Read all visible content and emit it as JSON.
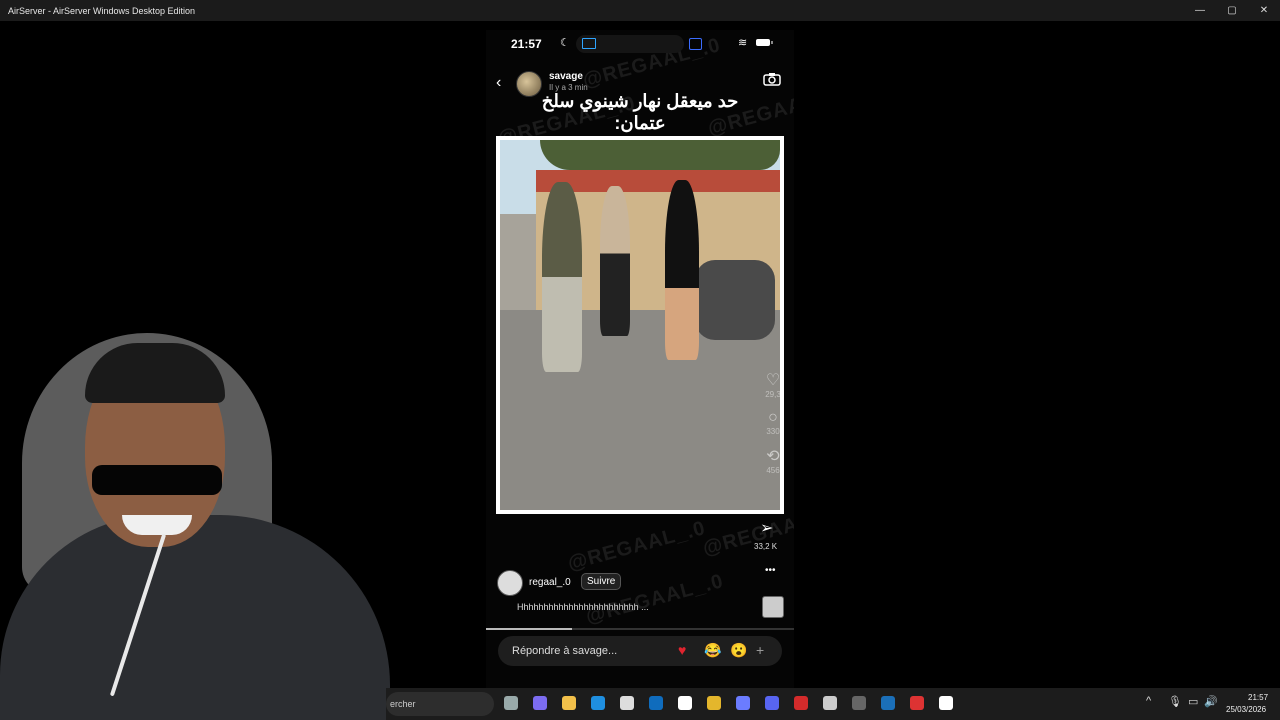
{
  "window": {
    "title": "AirServer - AirServer Windows Desktop Edition"
  },
  "phone": {
    "status": {
      "time": "21:57"
    },
    "story": {
      "username": "savage",
      "posted": "Il y a 3  min",
      "caption_arabic": "حد ميعقل نهار شينوي سلخ عتمان:",
      "watermark": "@REGAAL_.0"
    },
    "side": {
      "likes": "29,3",
      "comments": "330",
      "reposts": "456",
      "shares": "33,2 K"
    },
    "reel": {
      "username": "regaal_.0",
      "follow_label": "Suivre",
      "caption": "Hhhhhhhhhhhhhhhhhhhhhhhh ..."
    },
    "progress": 0.28,
    "reply": {
      "placeholder": "Répondre à savage...",
      "add": "+"
    }
  },
  "taskbar": {
    "search_text": "ercher",
    "time": "21:57",
    "date": "25/03/2026",
    "icons": [
      "file-explorer-icon",
      "copilot-icon",
      "folder-icon",
      "edge-icon",
      "store-icon",
      "outlook-icon",
      "airserver-icon",
      "chrome-icon",
      "game-icon",
      "discord-icon",
      "acrobat-icon",
      "openai-icon",
      "obs-icon",
      "steam-icon",
      "brand-icon",
      "app-icon"
    ]
  },
  "colors": {
    "titlebar": "#1b1b1b",
    "taskbar": "#1c1c1c",
    "heart": "#e0242f",
    "cast": "#2fa5ff"
  }
}
